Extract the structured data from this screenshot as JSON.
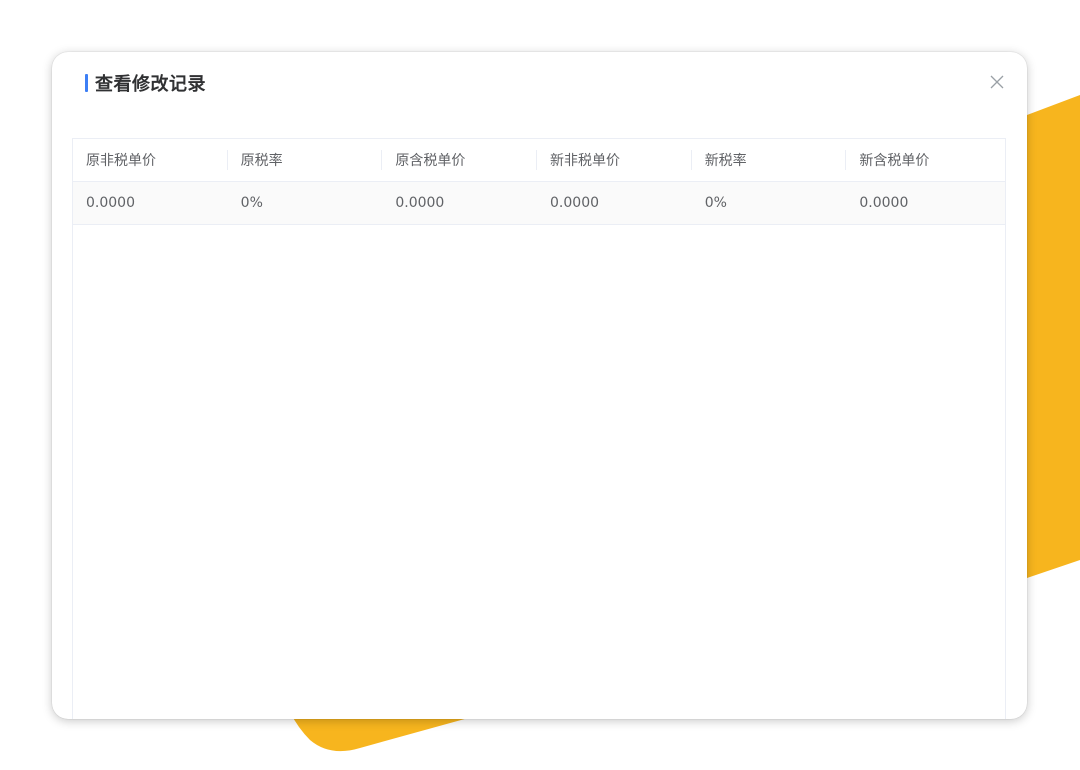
{
  "dialog": {
    "title": "查看修改记录",
    "close_icon": "close-icon"
  },
  "table": {
    "columns": [
      "原非税单价",
      "原税率",
      "原含税单价",
      "新非税单价",
      "新税率",
      "新含税单价"
    ],
    "rows": [
      [
        "0.0000",
        "0%",
        "0.0000",
        "0.0000",
        "0%",
        "0.0000"
      ]
    ]
  },
  "colors": {
    "accent": "#3d7ff5",
    "background_decoration": "#f7b51e"
  }
}
